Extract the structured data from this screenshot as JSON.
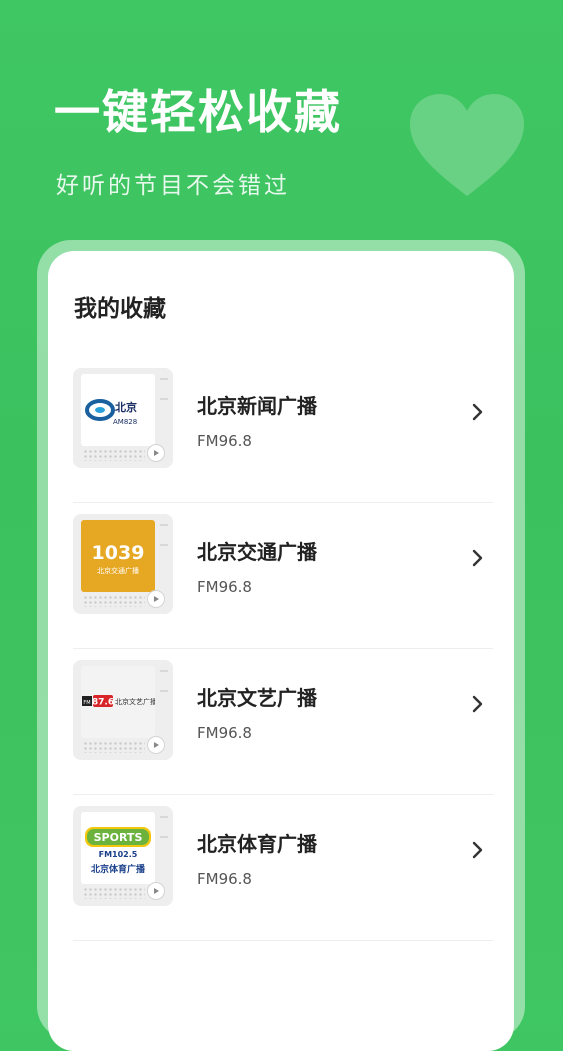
{
  "hero": {
    "title": "一键轻松收藏",
    "subtitle": "好听的节目不会错过"
  },
  "favorites": {
    "title": "我的收藏",
    "items": [
      {
        "name": "北京新闻广播",
        "freq": "FM96.8",
        "logo": {
          "type": "news",
          "text1": "北京",
          "text2": "AM828",
          "icon": "bjnews-swirl-logo"
        }
      },
      {
        "name": "北京交通广播",
        "freq": "FM96.8",
        "logo": {
          "type": "traffic",
          "text1": "1039",
          "text2": "北京交通广播",
          "color": "#e6a722"
        }
      },
      {
        "name": "北京文艺广播",
        "freq": "FM96.8",
        "logo": {
          "type": "arts",
          "text1": "FM",
          "text2": "87.6",
          "text3": "北京文艺广播",
          "color": "#d8252a"
        }
      },
      {
        "name": "北京体育广播",
        "freq": "FM96.8",
        "logo": {
          "type": "sports",
          "text1": "SPORTS",
          "text2": "FM102.5",
          "text3": "北京体育广播",
          "color": "#6cb33e"
        }
      }
    ]
  },
  "colors": {
    "background": "#3fc763",
    "card": "#ffffff",
    "title_text": "#222222"
  }
}
